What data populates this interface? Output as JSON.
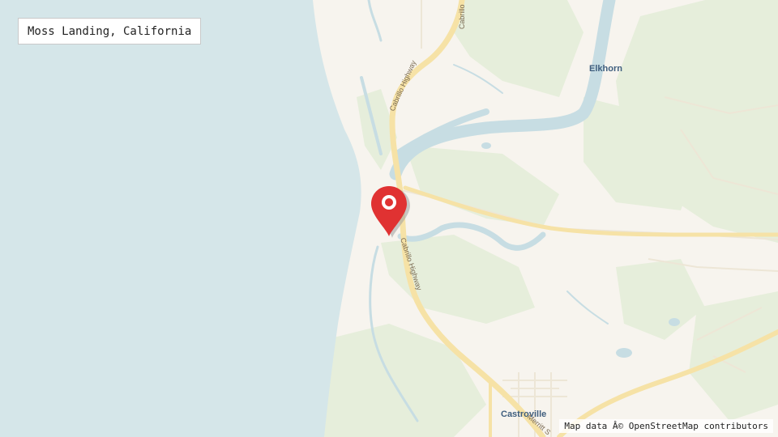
{
  "map": {
    "title": "Moss Landing, California",
    "attribution": "Map data Â© OpenStreetMap contributors",
    "places": {
      "elkhorn": "Elkhorn",
      "castroville": "Castroville"
    },
    "roads": {
      "cabrillo_top": "Cabrillo",
      "cabrillo_highway_north": "Cabrillo Highway",
      "cabrillo_highway_south": "Cabrillo Highway",
      "merritt": "Merritt S"
    },
    "marker": {
      "icon": "location-pin-icon",
      "color": "#e03232"
    },
    "colors": {
      "ocean": "#d5e6e9",
      "land": "#f7f4ee",
      "green": "#e6eedb",
      "water": "#c7dde3",
      "highway": "#f6e2a6",
      "minor_road": "#ede6d6"
    }
  }
}
